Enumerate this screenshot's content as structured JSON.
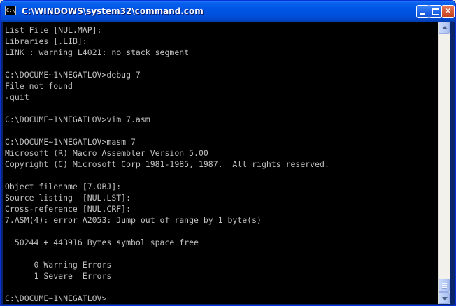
{
  "window": {
    "title": "C:\\WINDOWS\\system32\\command.com",
    "icon": "console-icon",
    "icon_glyph": "C:\\",
    "controls": {
      "minimize": "minimize-icon",
      "maximize": "maximize-icon",
      "close": "close-icon",
      "close_glyph": "✕"
    }
  },
  "console": {
    "lines": [
      "List File [NUL.MAP]:",
      "Libraries [.LIB]:",
      "LINK : warning L4021: no stack segment",
      "",
      "C:\\DOCUME~1\\NEGATLOV>debug 7",
      "File not found",
      "-quit",
      "",
      "C:\\DOCUME~1\\NEGATLOV>vim 7.asm",
      "",
      "C:\\DOCUME~1\\NEGATLOV>masm 7",
      "Microsoft (R) Macro Assembler Version 5.00",
      "Copyright (C) Microsoft Corp 1981-1985, 1987.  All rights reserved.",
      "",
      "Object filename [7.OBJ]:",
      "Source listing  [NUL.LST]:",
      "Cross-reference [NUL.CRF]:",
      "7.ASM(4): error A2053: Jump out of range by 1 byte(s)",
      "",
      "  50244 + 443916 Bytes symbol space free",
      "",
      "      0 Warning Errors",
      "      1 Severe  Errors",
      "",
      "C:\\DOCUME~1\\NEGATLOV>"
    ]
  },
  "colors": {
    "titlebar": "#0054e3",
    "console_bg": "#000000",
    "console_text": "#c0c0c0",
    "close_button": "#d45231"
  }
}
